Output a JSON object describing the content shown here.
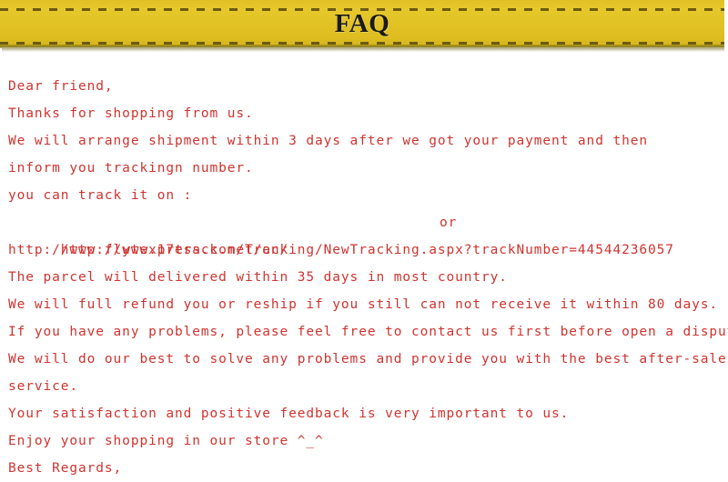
{
  "banner": {
    "title": "FAQ",
    "background_color": "#e3c425",
    "title_color": "#1b1b1b",
    "dash_color": "#6b5a10"
  },
  "body": {
    "text_color": "#cf3430",
    "lines": [
      {
        "id": "greeting",
        "text": "Dear friend,"
      },
      {
        "id": "thanks",
        "text": "Thanks for shopping from us."
      },
      {
        "id": "shipment-time",
        "text": "We will arrange shipment within 3 days after we got your payment and then"
      },
      {
        "id": "inform-tracking",
        "text": "inform you trackingn number."
      },
      {
        "id": "track-intro",
        "text": "you can track it on :"
      },
      {
        "id": "track-url-1",
        "text": "http://www.17track.net/en/",
        "suffix": "or"
      },
      {
        "id": "track-url-2",
        "text": "http://www.flytexpress.com/Tracking/NewTracking.aspx?trackNumber=44544236057"
      },
      {
        "id": "delivery-time",
        "text": "The parcel will delivered within 35 days in most country."
      },
      {
        "id": "refund-policy",
        "text": "We will full refund you or reship if you still can not receive it within 80 days."
      },
      {
        "id": "contact-first",
        "text": "If you have any problems, please feel free to contact us first before open a dispute."
      },
      {
        "id": "best-effort",
        "text": "We will do our best to solve any problems and provide you with the best after-sale"
      },
      {
        "id": "service",
        "text": "service."
      },
      {
        "id": "feedback",
        "text": "Your satisfaction and positive feedback is very important to us."
      },
      {
        "id": "enjoy",
        "text": "Enjoy your shopping in our store ^_^"
      },
      {
        "id": "signoff",
        "text": "Best Regards,"
      }
    ]
  },
  "tracking": {
    "track_number": "44544236057",
    "site_1": "http://www.17track.net/en/",
    "site_2": "http://www.flytexpress.com/Tracking/NewTracking.aspx?trackNumber=44544236057",
    "separator": "or"
  }
}
